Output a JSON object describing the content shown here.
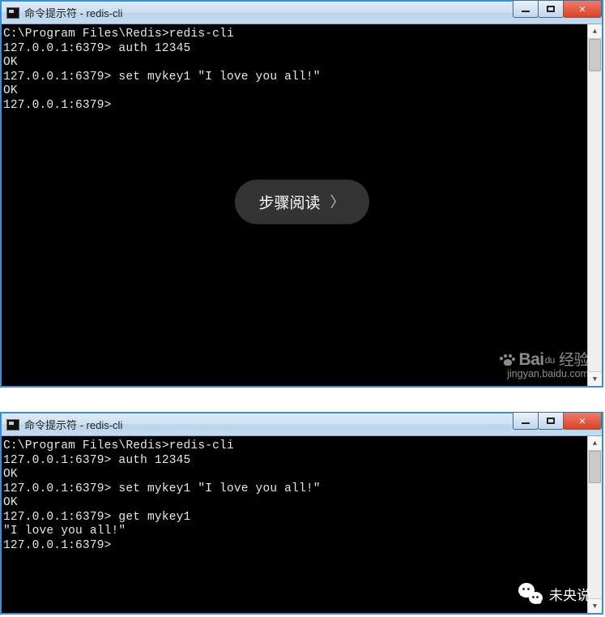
{
  "window1": {
    "title": "命令提示符 - redis-cli",
    "terminal_lines": [
      "C:\\Program Files\\Redis>redis-cli",
      "127.0.0.1:6379> auth 12345",
      "OK",
      "127.0.0.1:6379> set mykey1 \"I love you all!\"",
      "OK",
      "127.0.0.1:6379>"
    ],
    "overlay_label": "步骤阅读",
    "watermark_brand_prefix": "Bai",
    "watermark_brand_du": "du",
    "watermark_brand_suffix": "经验",
    "watermark_url": "jingyan.baidu.com"
  },
  "window2": {
    "title": "命令提示符 - redis-cli",
    "terminal_lines": [
      "C:\\Program Files\\Redis>redis-cli",
      "127.0.0.1:6379> auth 12345",
      "OK",
      "127.0.0.1:6379> set mykey1 \"I love you all!\"",
      "OK",
      "127.0.0.1:6379> get mykey1",
      "\"I love you all!\"",
      "127.0.0.1:6379>"
    ]
  },
  "footer_tag": "未央说",
  "colors": {
    "window_border": "#3a8fd4",
    "close_btn": "#d84328",
    "terminal_bg": "#000000",
    "terminal_fg": "#e8e8e8"
  }
}
